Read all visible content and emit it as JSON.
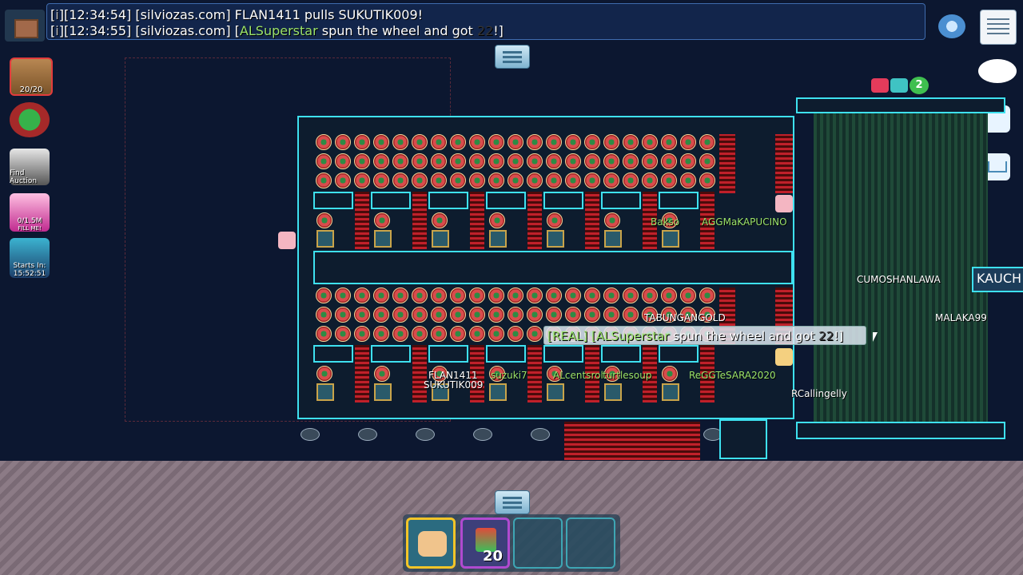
{
  "chat": {
    "line1": {
      "prefix": "[",
      "bullet": "i",
      "suffix": "][12:34:54] [silviozas.com] FLAN1411 pulls SUKUTIK009!"
    },
    "line2": {
      "prefix": "[",
      "bullet": "i",
      "suffix": "][12:34:55] [silviozas.com] [",
      "player": "ALSuperstar",
      "action": " spun the wheel and got ",
      "number": "22",
      "end": "!]"
    }
  },
  "sidebar": {
    "backpack": {
      "label": "20/20"
    },
    "find_auction": {
      "label": "Find Auction"
    },
    "piggy": {
      "label": "0/1.5M",
      "sub": "FILL ME!"
    },
    "event": {
      "label": "Starts In:",
      "time": "15:52:51"
    }
  },
  "overhead_message": {
    "prefix": "[REAL] [",
    "player": "ALSuperstar",
    "text": " spun the wheel and got ",
    "number": "22",
    "end": "!]"
  },
  "top_right_badge": {
    "value": "2"
  },
  "kauch_label": "KAUCH",
  "players": [
    {
      "name": "Bakso",
      "color": "#9be36a"
    },
    {
      "name": "AGGMaKAPUCINO",
      "color": "#9be36a"
    },
    {
      "name": "TABUNGANGOLD",
      "color": "#ffffff"
    },
    {
      "name": "FLAN1411",
      "color": "#ffffff"
    },
    {
      "name": "SUKUTIK009",
      "color": "#ffffff"
    },
    {
      "name": "suzuki7",
      "color": "#9be36a"
    },
    {
      "name": "ALcentsrol",
      "color": "#9be36a"
    },
    {
      "name": "turtlesoup",
      "color": "#9be36a"
    },
    {
      "name": "ReGGTeSARA2020",
      "color": "#9be36a"
    },
    {
      "name": "RCallingelly",
      "color": "#ffffff"
    },
    {
      "name": "CUMOSHANLAWA",
      "color": "#ffffff"
    },
    {
      "name": "MALAKA99",
      "color": "#ffffff"
    }
  ],
  "inventory": {
    "slot1": {
      "item": "fist-icon"
    },
    "slot2": {
      "item": "sparkle-item-icon",
      "count": "20"
    },
    "slot3": {
      "item": ""
    },
    "slot4": {
      "item": ""
    }
  },
  "colors": {
    "frame": "#3ee1f0",
    "chat_green": "#9be36a",
    "background": "#0c1730"
  }
}
